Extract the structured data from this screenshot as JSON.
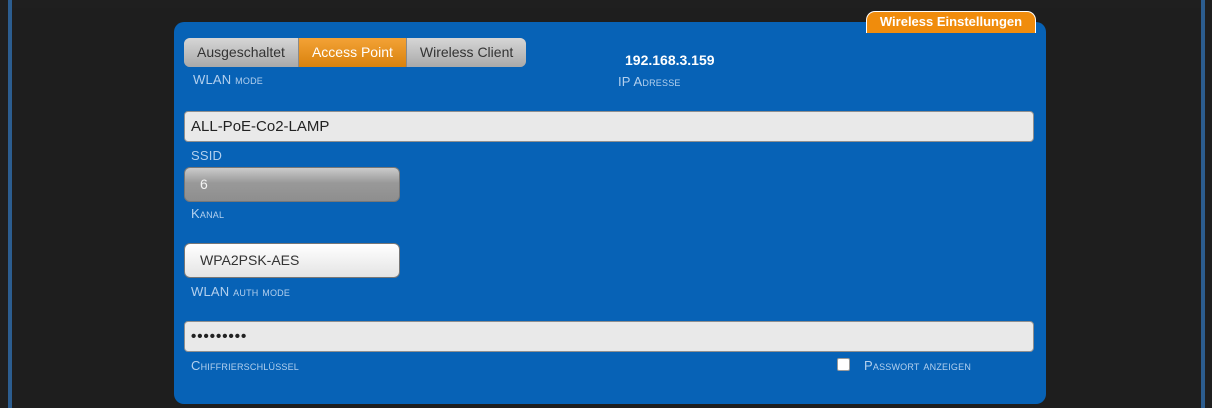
{
  "section_title": "Wireless Einstellungen",
  "wlan_mode": {
    "label": "WLAN mode",
    "options": [
      "Ausgeschaltet",
      "Access Point",
      "Wireless Client"
    ],
    "selected": "Access Point"
  },
  "ip": {
    "value": "192.168.3.159",
    "label": "IP Adresse"
  },
  "ssid": {
    "value": "ALL-PoE-Co2-LAMP",
    "label": "SSID"
  },
  "kanal": {
    "value": "6",
    "label": "Kanal"
  },
  "auth": {
    "value": "WPA2PSK-AES",
    "label": "WLAN auth mode"
  },
  "key": {
    "value": "•••••••••",
    "label": "Chiffrierschlüssel"
  },
  "show_password": {
    "label": "Passwort anzeigen",
    "checked": false
  }
}
